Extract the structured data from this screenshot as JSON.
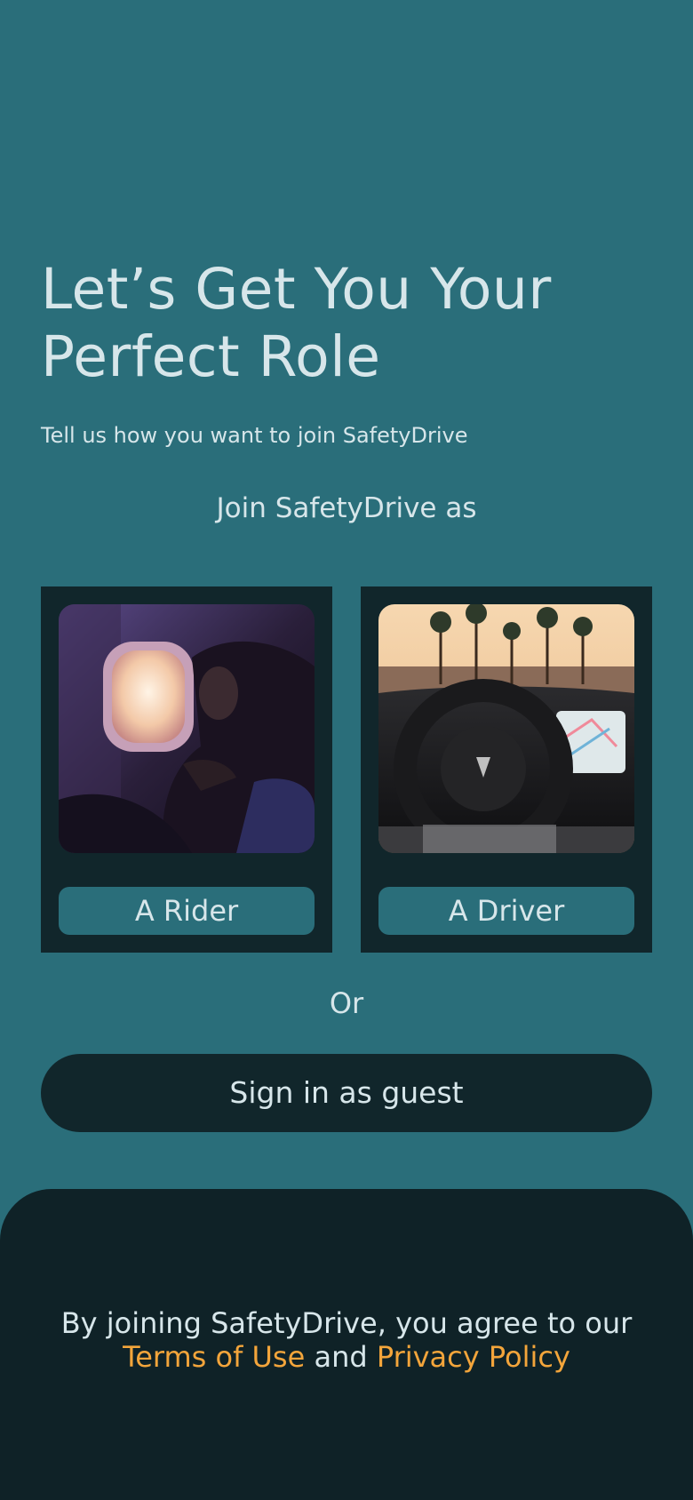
{
  "header": {
    "title_line1": "Let’s Get You Your",
    "title_line2": "Perfect Role",
    "subtitle": "Tell us how you want to join SafetyDrive"
  },
  "join": {
    "prompt": "Join SafetyDrive as"
  },
  "roles": [
    {
      "label": "A Rider",
      "image": "rider-photo"
    },
    {
      "label": "A Driver",
      "image": "driver-photo"
    }
  ],
  "divider": {
    "or": "Or"
  },
  "guest": {
    "label": "Sign in as guest"
  },
  "footer": {
    "agreement_prefix": "By joining SafetyDrive, you agree to our",
    "terms_link": "Terms of Use",
    "and": "and",
    "privacy_link": "Privacy Policy"
  },
  "colors": {
    "background": "#2a6e7a",
    "card": "#11262b",
    "footer": "#0f2227",
    "text": "#d7e6ea",
    "accent": "#f3a53b"
  }
}
